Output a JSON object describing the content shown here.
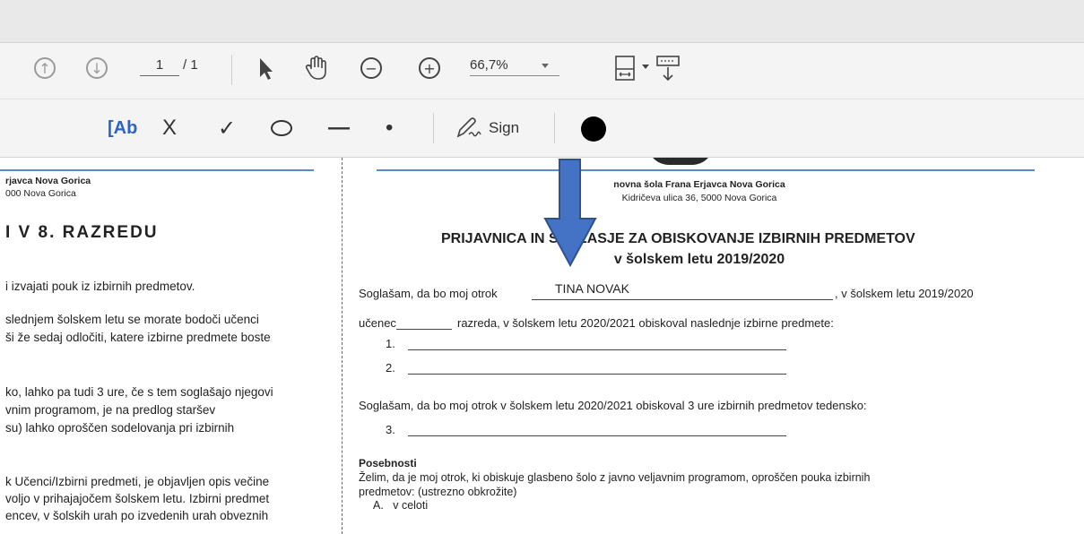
{
  "toolbar": {
    "page_current": "1",
    "page_total": "/ 1",
    "zoom": "66,7%",
    "text_tool": "[Ab",
    "cross": "X",
    "check": "✓",
    "dash": "—",
    "dot": "•",
    "sign_label": "Sign"
  },
  "left_page": {
    "school_name": "rjavca Nova Gorica",
    "school_address": "000 Nova Gorica",
    "heading": "I V 8. RAZREDU",
    "lines": [
      "i izvajati pouk iz izbirnih predmetov.",
      "slednjem šolskem letu se morate bodoči učenci",
      "ši že sedaj odločiti, katere izbirne predmete boste",
      "ko, lahko pa tudi 3 ure, če s tem soglašajo njegovi",
      "vnim programom, je na predlog staršev",
      "su) lahko oproščen sodelovanja pri izbirnih",
      "k Učenci/Izbirni predmeti, je objavljen opis večine",
      "voljo v prihajajočem šolskem letu. Izbirni predmet",
      "encev, v šolskih urah po izvedenih urah obveznih"
    ]
  },
  "right_page": {
    "school_name": "novna šola Frana Erjavca Nova Gorica",
    "school_address": "Kidričeva ulica 36, 5000 Nova Gorica",
    "title_line1": "PRIJAVNICA IN S     LASJE ZA OBISKOVANJE IZBIRNIH PREDMETOV",
    "title_line2": "v šolskem letu 2019/2020",
    "consent_prefix": "Soglašam, da bo moj otrok",
    "child_name": "TINA NOVAK",
    "consent_suffix": ", v šolskem letu 2019/2020",
    "grade_prefix": "učenec",
    "grade_suffix": "razreda, v šolskem letu 2020/2021 obiskoval naslednje izbirne predmete:",
    "item1": "1.",
    "item2": "2.",
    "consent3": "Soglašam, da bo moj otrok v šolskem letu 2020/2021 obiskoval 3 ure izbirnih predmetov tedensko:",
    "item3": "3.",
    "special_heading": "Posebnosti",
    "special_line1": "Želim, da je moj otrok, ki obiskuje glasbeno šolo z javno veljavnim programom, oproščen pouka izbirnih",
    "special_line2": "predmetov: (ustrezno obkrožite)",
    "option_a": "A.   v celoti"
  },
  "colors": {
    "accent_blue": "#4472c4",
    "header_line": "#5b8bc5",
    "toolbar_bg": "#f4f4f4"
  }
}
